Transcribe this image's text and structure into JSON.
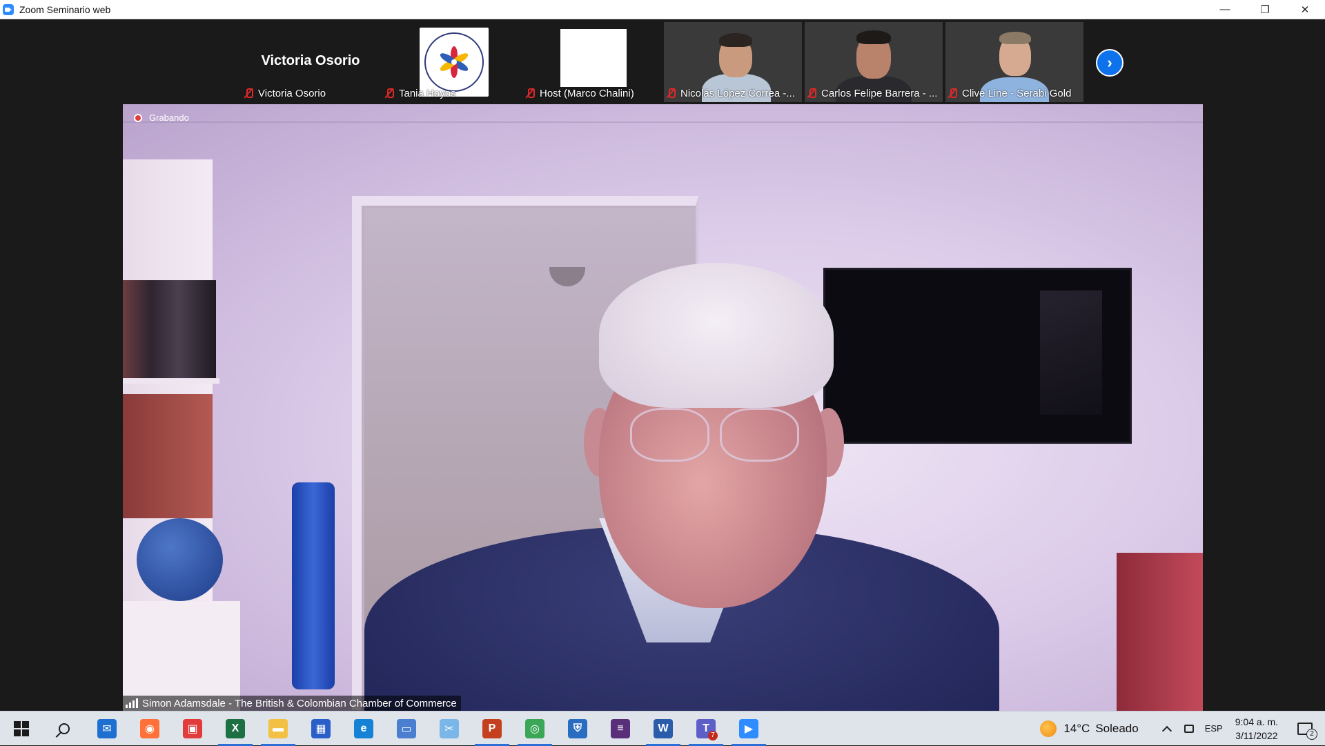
{
  "window": {
    "title": "Zoom Seminario web",
    "minimize": "—",
    "restore": "❐",
    "close": "✕"
  },
  "filmstrip": {
    "tiles": [
      {
        "kind": "name",
        "display_name": "Victoria Osorio",
        "caption": "Victoria Osorio",
        "muted": true
      },
      {
        "kind": "logo",
        "caption": "Tania Hoyos",
        "muted": true
      },
      {
        "kind": "blank",
        "caption": "Host (Marco Chalini)",
        "muted": true
      },
      {
        "kind": "video",
        "caption": "Nicolás López Correa -...",
        "muted": true
      },
      {
        "kind": "video",
        "caption": "Carlos Felipe Barrera - ...",
        "muted": true
      },
      {
        "kind": "video",
        "caption": "Clive Line - Serabi Gold",
        "muted": true
      }
    ],
    "next_icon": "›"
  },
  "speaker": {
    "recording_label": "Grabando",
    "name": "Simon Adamsdale - The British & Colombian Chamber of Commerce"
  },
  "taskbar": {
    "apps": [
      {
        "name": "start-button",
        "icon": "windows-icon"
      },
      {
        "name": "search-button",
        "icon": "search-icon"
      },
      {
        "name": "mail",
        "icon": "mail-icon",
        "color": "#1f6fd1",
        "glyph": "✉"
      },
      {
        "name": "firefox",
        "icon": "firefox-icon",
        "color": "#ff7139",
        "glyph": "◉"
      },
      {
        "name": "gift-app",
        "icon": "gift-icon",
        "color": "#e23b3b",
        "glyph": "▣"
      },
      {
        "name": "excel",
        "icon": "excel-icon",
        "color": "#1d7044",
        "glyph": "X",
        "open": true
      },
      {
        "name": "file-explorer",
        "icon": "folder-icon",
        "color": "#f2c144",
        "glyph": "▬",
        "open": true
      },
      {
        "name": "microsoft-store",
        "icon": "store-icon",
        "color": "#2a5ec9",
        "glyph": "▦"
      },
      {
        "name": "edge",
        "icon": "edge-icon",
        "color": "#1582d6",
        "glyph": "e"
      },
      {
        "name": "remote-desktop",
        "icon": "remote-desktop-icon",
        "color": "#4a7fd0",
        "glyph": "▭"
      },
      {
        "name": "snipping-tool",
        "icon": "scissors-icon",
        "color": "#7ab6e8",
        "glyph": "✂"
      },
      {
        "name": "powerpoint",
        "icon": "powerpoint-icon",
        "color": "#c4401e",
        "glyph": "P",
        "open": true
      },
      {
        "name": "chrome",
        "icon": "chrome-icon",
        "color": "#3aa757",
        "glyph": "◎",
        "open": true
      },
      {
        "name": "security-app",
        "icon": "shield-icon",
        "color": "#2a6cc0",
        "glyph": "⛨"
      },
      {
        "name": "winrar",
        "icon": "archive-icon",
        "color": "#5a2f7a",
        "glyph": "≡"
      },
      {
        "name": "word",
        "icon": "word-icon",
        "color": "#2b5cab",
        "glyph": "W",
        "open": true
      },
      {
        "name": "teams",
        "icon": "teams-icon",
        "color": "#5b5fc7",
        "glyph": "T",
        "badge": "7",
        "open": true
      },
      {
        "name": "zoom",
        "icon": "zoom-icon",
        "color": "#2d8cff",
        "glyph": "▶",
        "open": true
      }
    ],
    "weather": {
      "temp": "14°C",
      "condition": "Soleado"
    },
    "language": "ESP",
    "time": "9:04 a. m.",
    "date": "3/11/2022",
    "notification_count": "2"
  }
}
